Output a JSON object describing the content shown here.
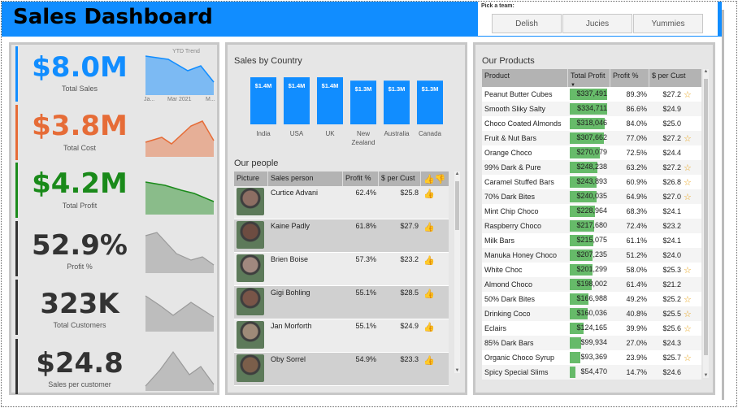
{
  "header": {
    "title": "Sales Dashboard",
    "accent": "#118DFF"
  },
  "slicer": {
    "label": "Pick a team:",
    "options": [
      "Delish",
      "Jucies",
      "Yummies"
    ]
  },
  "kpis": [
    {
      "value": "$8.0M",
      "caption": "Total Sales",
      "color": "#118DFF",
      "trend_label": "YTD Trend",
      "axis": [
        "Ja...",
        "Mar 2021",
        "M..."
      ]
    },
    {
      "value": "$3.8M",
      "caption": "Total Cost",
      "color": "#E66C37"
    },
    {
      "value": "$4.2M",
      "caption": "Total Profit",
      "color": "#1A8A1A"
    },
    {
      "value": "52.9%",
      "caption": "Profit %",
      "color": "#333333"
    },
    {
      "value": "323K",
      "caption": "Total Customers",
      "color": "#333333"
    },
    {
      "value": "$24.8",
      "caption": "Sales per customer",
      "color": "#333333"
    }
  ],
  "country_chart": {
    "title": "Sales by Country",
    "chart_data": {
      "type": "bar",
      "categories": [
        "India",
        "USA",
        "UK",
        "New Zealand",
        "Australia",
        "Canada"
      ],
      "values": [
        1.4,
        1.4,
        1.4,
        1.3,
        1.3,
        1.3
      ],
      "labels": [
        "$1.4M",
        "$1.4M",
        "$1.4M",
        "$1.3M",
        "$1.3M",
        "$1.3M"
      ],
      "color": "#118DFF"
    }
  },
  "people": {
    "title": "Our people",
    "columns": [
      "Picture",
      "Sales person",
      "Profit %",
      "$ per Cust"
    ],
    "rows": [
      {
        "name": "Curtice Advani",
        "profit": "62.4%",
        "per_cust": "$25.8"
      },
      {
        "name": "Kaine Padly",
        "profit": "61.8%",
        "per_cust": "$27.9"
      },
      {
        "name": "Brien Boise",
        "profit": "57.3%",
        "per_cust": "$23.2"
      },
      {
        "name": "Gigi Bohling",
        "profit": "55.1%",
        "per_cust": "$28.5"
      },
      {
        "name": "Jan Morforth",
        "profit": "55.1%",
        "per_cust": "$24.9"
      },
      {
        "name": "Oby Sorrel",
        "profit": "54.9%",
        "per_cust": "$23.3"
      }
    ]
  },
  "products": {
    "title": "Our Products",
    "columns": [
      "Product",
      "Total Profit",
      "Profit %",
      "$ per Cust"
    ],
    "rows": [
      {
        "name": "Peanut Butter Cubes",
        "profit": "$337,491",
        "ratio": 1.0,
        "pct": "89.3%",
        "per_cust": "$27.2",
        "star": true
      },
      {
        "name": "Smooth Sliky Salty",
        "profit": "$334,711",
        "ratio": 0.99,
        "pct": "86.6%",
        "per_cust": "$24.9",
        "star": false
      },
      {
        "name": "Choco Coated Almonds",
        "profit": "$318,046",
        "ratio": 0.94,
        "pct": "84.0%",
        "per_cust": "$25.0",
        "star": false
      },
      {
        "name": "Fruit & Nut Bars",
        "profit": "$307,662",
        "ratio": 0.91,
        "pct": "77.0%",
        "per_cust": "$27.2",
        "star": true
      },
      {
        "name": "Orange Choco",
        "profit": "$270,079",
        "ratio": 0.8,
        "pct": "72.5%",
        "per_cust": "$24.4",
        "star": false
      },
      {
        "name": "99% Dark & Pure",
        "profit": "$248,238",
        "ratio": 0.74,
        "pct": "63.2%",
        "per_cust": "$27.2",
        "star": true
      },
      {
        "name": "Caramel Stuffed Bars",
        "profit": "$243,893",
        "ratio": 0.72,
        "pct": "60.9%",
        "per_cust": "$26.8",
        "star": true
      },
      {
        "name": "70% Dark Bites",
        "profit": "$240,035",
        "ratio": 0.71,
        "pct": "64.9%",
        "per_cust": "$27.0",
        "star": true
      },
      {
        "name": "Mint Chip Choco",
        "profit": "$228,964",
        "ratio": 0.68,
        "pct": "68.3%",
        "per_cust": "$24.1",
        "star": false
      },
      {
        "name": "Raspberry Choco",
        "profit": "$217,680",
        "ratio": 0.65,
        "pct": "72.4%",
        "per_cust": "$23.2",
        "star": false
      },
      {
        "name": "Milk Bars",
        "profit": "$215,075",
        "ratio": 0.64,
        "pct": "61.1%",
        "per_cust": "$24.1",
        "star": false
      },
      {
        "name": "Manuka Honey Choco",
        "profit": "$207,235",
        "ratio": 0.61,
        "pct": "51.2%",
        "per_cust": "$24.0",
        "star": false
      },
      {
        "name": "White Choc",
        "profit": "$201,299",
        "ratio": 0.6,
        "pct": "58.0%",
        "per_cust": "$25.3",
        "star": true
      },
      {
        "name": "Almond Choco",
        "profit": "$198,002",
        "ratio": 0.59,
        "pct": "61.4%",
        "per_cust": "$21.2",
        "star": false
      },
      {
        "name": "50% Dark Bites",
        "profit": "$166,988",
        "ratio": 0.49,
        "pct": "49.2%",
        "per_cust": "$25.2",
        "star": true
      },
      {
        "name": "Drinking Coco",
        "profit": "$160,036",
        "ratio": 0.47,
        "pct": "40.8%",
        "per_cust": "$25.5",
        "star": true
      },
      {
        "name": "Eclairs",
        "profit": "$124,165",
        "ratio": 0.37,
        "pct": "39.9%",
        "per_cust": "$25.6",
        "star": true
      },
      {
        "name": "85% Dark Bars",
        "profit": "$99,934",
        "ratio": 0.3,
        "pct": "27.0%",
        "per_cust": "$24.3",
        "star": false
      },
      {
        "name": "Organic Choco Syrup",
        "profit": "$93,369",
        "ratio": 0.28,
        "pct": "23.9%",
        "per_cust": "$25.7",
        "star": true
      },
      {
        "name": "Spicy Special Slims",
        "profit": "$54,470",
        "ratio": 0.16,
        "pct": "14.7%",
        "per_cust": "$24.6",
        "star": false
      }
    ]
  }
}
